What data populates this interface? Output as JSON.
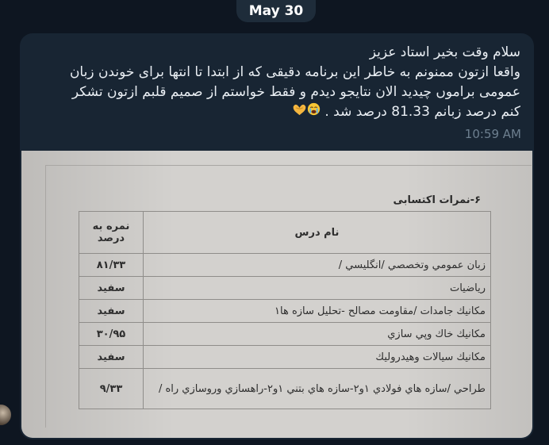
{
  "date_pill": "May 30",
  "message": {
    "lines": [
      "سلام وقت بخیر استاد عزیز",
      "واقعا ازتون ممنونم به خاطر این برنامه دقیقی که از ابتدا تا انتها برای خوندن زبان",
      "عمومی براموں چیدید الان نتایجو دیدم و فقط خواستم از صمیم قلبم ازتون تشکر",
      "کنم درصد زبانم 81.33 درصد شد ."
    ],
    "emojis": [
      "loudly-crying-face",
      "heart-hands"
    ],
    "time": "10:59 AM"
  },
  "document": {
    "section_title": "۶-نمرات اکتسابی",
    "headers": {
      "course": "نام درس",
      "grade": "نمره به درصد"
    },
    "rows": [
      {
        "course": "زبان عمومي وتخصصي /انگليسي /",
        "grade": "۸۱/۳۳"
      },
      {
        "course": "رياضيات",
        "grade": "سفيد"
      },
      {
        "course": "مكانيك جامدات /مقاومت مصالح -تحليل سازه ها۱",
        "grade": "سفيد"
      },
      {
        "course": "مكانيك خاك وپي سازي",
        "grade": "۳۰/۹۵"
      },
      {
        "course": "مكانيك سيالات وهيدروليك",
        "grade": "سفيد"
      },
      {
        "course": "طراحي /سازه هاي فولادي ۱و۲-سازه هاي بتني ۱و۲-راهسازي وروسازي راه /",
        "grade": "۹/۳۳"
      }
    ]
  },
  "colors": {
    "background": "#0e1621",
    "bubble": "#182533",
    "text": "#e9eef3",
    "time": "#6d7f8f"
  }
}
